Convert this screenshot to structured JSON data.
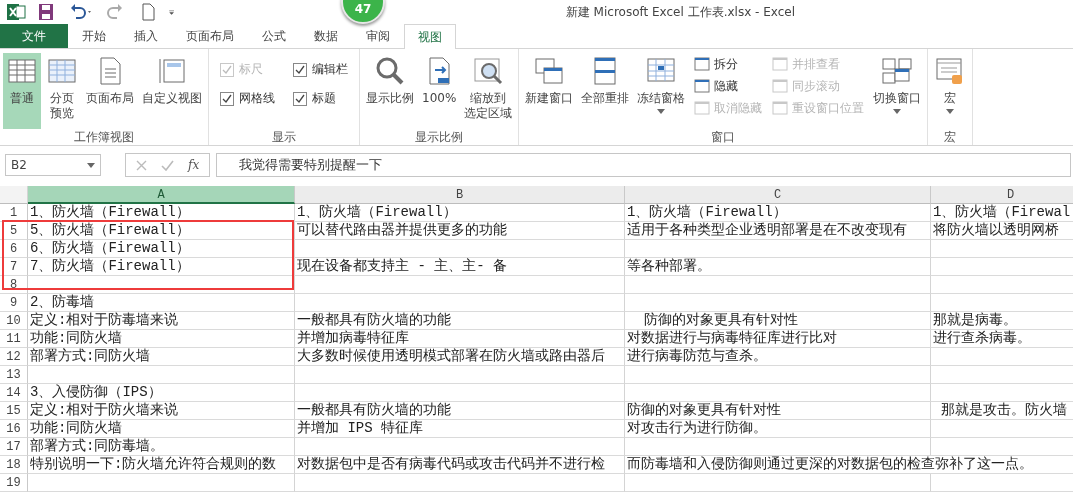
{
  "window": {
    "title": "新建 Microsoft Excel 工作表.xlsx - Excel"
  },
  "badge": "47",
  "tabs": [
    {
      "label": "文件",
      "kind": "file",
      "selected": false
    },
    {
      "label": "开始",
      "kind": "tab",
      "selected": false
    },
    {
      "label": "插入",
      "kind": "tab",
      "selected": false
    },
    {
      "label": "页面布局",
      "kind": "tab",
      "selected": false
    },
    {
      "label": "公式",
      "kind": "tab",
      "selected": false
    },
    {
      "label": "数据",
      "kind": "tab",
      "selected": false
    },
    {
      "label": "审阅",
      "kind": "tab",
      "selected": false
    },
    {
      "label": "视图",
      "kind": "tab",
      "selected": true
    }
  ],
  "ribbon": [
    {
      "label": "工作簿视图",
      "items": [
        {
          "kind": "big",
          "lines": [
            "普通"
          ],
          "selected": true
        },
        {
          "kind": "big",
          "lines": [
            "分页",
            "预览"
          ],
          "selected": false
        },
        {
          "kind": "big",
          "lines": [
            "页面布局"
          ],
          "selected": false
        },
        {
          "kind": "big",
          "lines": [
            "自定义视图"
          ],
          "selected": false
        }
      ]
    },
    {
      "label": "显示",
      "items": [
        {
          "kind": "checks",
          "items": [
            {
              "label": "标尺",
              "checked": true,
              "disabled": true
            },
            {
              "label": "网格线",
              "checked": true,
              "disabled": false
            }
          ]
        },
        {
          "kind": "checks",
          "items": [
            {
              "label": "编辑栏",
              "checked": true,
              "disabled": false
            },
            {
              "label": "标题",
              "checked": true,
              "disabled": false
            }
          ]
        }
      ]
    },
    {
      "label": "显示比例",
      "items": [
        {
          "kind": "big",
          "lines": [
            "显示比例"
          ],
          "selected": false
        },
        {
          "kind": "big",
          "lines": [
            "100%"
          ],
          "selected": false
        },
        {
          "kind": "big",
          "lines": [
            "缩放到",
            "选定区域"
          ],
          "selected": false
        }
      ]
    },
    {
      "label": "窗口",
      "items": [
        {
          "kind": "big",
          "lines": [
            "新建窗口"
          ],
          "selected": false
        },
        {
          "kind": "big",
          "lines": [
            "全部重排"
          ],
          "selected": false
        },
        {
          "kind": "big",
          "lines": [
            "冻结窗格"
          ],
          "selected": false,
          "dropdown": true
        },
        {
          "kind": "stack",
          "items": [
            {
              "label": "拆分",
              "disabled": false
            },
            {
              "label": "隐藏",
              "disabled": false
            },
            {
              "label": "取消隐藏",
              "disabled": true
            }
          ]
        },
        {
          "kind": "stack",
          "items": [
            {
              "label": "并排查看",
              "disabled": true
            },
            {
              "label": "同步滚动",
              "disabled": true
            },
            {
              "label": "重设窗口位置",
              "disabled": true
            }
          ]
        },
        {
          "kind": "big",
          "lines": [
            "切换窗口"
          ],
          "selected": false,
          "dropdown": true
        }
      ]
    },
    {
      "label": "宏",
      "items": [
        {
          "kind": "big",
          "lines": [
            "宏"
          ],
          "selected": false,
          "dropdown": true
        }
      ]
    }
  ],
  "formula_bar": {
    "name_box": "B2",
    "function_label": "fx",
    "value": "我觉得需要特别提醒一下"
  },
  "sheet": {
    "columns": [
      {
        "label": "A",
        "selected": true
      },
      {
        "label": "B",
        "selected": false
      },
      {
        "label": "C",
        "selected": false
      },
      {
        "label": "D",
        "selected": false
      }
    ],
    "rows": [
      {
        "header": "1",
        "cells": {
          "A": "1、防火墙（Firewall）",
          "B": "1、防火墙（Firewall）",
          "C": "1、防火墙（Firewall）",
          "D": "1、防火墙（Firewal"
        }
      },
      {
        "header": "5",
        "cells": {
          "A": "5、防火墙（Firewall）",
          "B": "可以替代路由器并提供更多的功能",
          "C": "适用于各种类型企业透明部署是在不改变现有",
          "D": "将防火墙以透明网桥"
        }
      },
      {
        "header": "6",
        "cells": {
          "A": "6、防火墙（Firewall）"
        }
      },
      {
        "header": "7",
        "cells": {
          "A": "7、防火墙（Firewall）",
          "B": "现在设备都支持主 - 主、主- 备",
          "C": "等各种部署。"
        }
      },
      {
        "header": "8",
        "cells": {}
      },
      {
        "header": "9",
        "cells": {
          "A": "2、防毒墙"
        }
      },
      {
        "header": "10",
        "cells": {
          "A": "定义:相对于防毒墙来说",
          "B": "一般都具有防火墙的功能",
          "C": "  防御的对象更具有针对性",
          "D": "那就是病毒。"
        }
      },
      {
        "header": "11",
        "cells": {
          "A": "功能:同防火墙",
          "B": "并增加病毒特征库",
          "C": "对数据进行与病毒特征库进行比对",
          "D": "进行查杀病毒。"
        }
      },
      {
        "header": "12",
        "cells": {
          "A": "部署方式:同防火墙",
          "B": "大多数时候使用透明模式部署在防火墙或路由器后",
          "C": "进行病毒防范与查杀。"
        }
      },
      {
        "header": "13",
        "cells": {}
      },
      {
        "header": "14",
        "cells": {
          "A": "3、入侵防御（IPS）"
        }
      },
      {
        "header": "15",
        "cells": {
          "A": "定义:相对于防火墙来说",
          "B": "一般都具有防火墙的功能",
          "C": "防御的对象更具有针对性",
          "D": " 那就是攻击。防火墙"
        }
      },
      {
        "header": "16",
        "cells": {
          "A": "功能:同防火墙",
          "B": "并增加 IPS 特征库",
          "C": "对攻击行为进行防御。"
        }
      },
      {
        "header": "17",
        "cells": {
          "A": "部署方式:同防毒墙。"
        }
      },
      {
        "header": "18",
        "cells": {
          "A": "特别说明一下:防火墙允许符合规则的数",
          "B": "对数据包中是否有病毒代码或攻击代码并不进行检",
          "C": "而防毒墙和入侵防御则通过更深的对数据包的检查弥补了这一点。"
        }
      },
      {
        "header": "19",
        "cells": {}
      }
    ]
  }
}
